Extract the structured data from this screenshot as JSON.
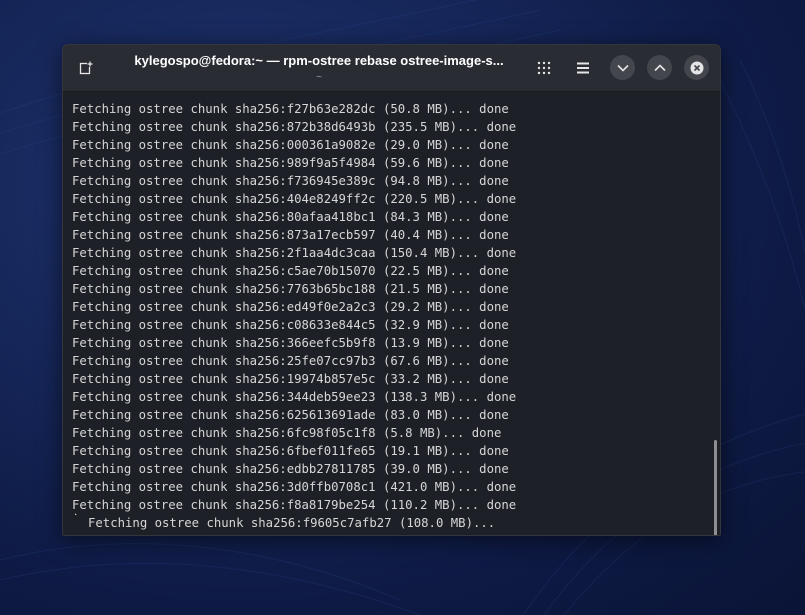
{
  "window": {
    "title": "kylegospo@fedora:~ — rpm-ostree rebase ostree-image-s...",
    "subtitle": "~"
  },
  "icons": {
    "new_tab": "new-tab-icon",
    "grid": "grid-menu-icon",
    "menu": "hamburger-menu-icon",
    "minimize": "chevron-down-icon",
    "maximize": "chevron-up-icon",
    "close": "close-icon"
  },
  "terminal": {
    "lines": [
      "Fetching ostree chunk sha256:f27b63e282dc (50.8 MB)... done",
      "Fetching ostree chunk sha256:872b38d6493b (235.5 MB)... done",
      "Fetching ostree chunk sha256:000361a9082e (29.0 MB)... done",
      "Fetching ostree chunk sha256:989f9a5f4984 (59.6 MB)... done",
      "Fetching ostree chunk sha256:f736945e389c (94.8 MB)... done",
      "Fetching ostree chunk sha256:404e8249ff2c (220.5 MB)... done",
      "Fetching ostree chunk sha256:80afaa418bc1 (84.3 MB)... done",
      "Fetching ostree chunk sha256:873a17ecb597 (40.4 MB)... done",
      "Fetching ostree chunk sha256:2f1aa4dc3caa (150.4 MB)... done",
      "Fetching ostree chunk sha256:c5ae70b15070 (22.5 MB)... done",
      "Fetching ostree chunk sha256:7763b65bc188 (21.5 MB)... done",
      "Fetching ostree chunk sha256:ed49f0e2a2c3 (29.2 MB)... done",
      "Fetching ostree chunk sha256:c08633e844c5 (32.9 MB)... done",
      "Fetching ostree chunk sha256:366eefc5b9f8 (13.9 MB)... done",
      "Fetching ostree chunk sha256:25fe07cc97b3 (67.6 MB)... done",
      "Fetching ostree chunk sha256:19974b857e5c (33.2 MB)... done",
      "Fetching ostree chunk sha256:344deb59ee23 (138.3 MB)... done",
      "Fetching ostree chunk sha256:625613691ade (83.0 MB)... done",
      "Fetching ostree chunk sha256:6fc98f05c1f8 (5.8 MB)... done",
      "Fetching ostree chunk sha256:6fbef011fe65 (19.1 MB)... done",
      "Fetching ostree chunk sha256:edbb27811785 (39.0 MB)... done",
      "Fetching ostree chunk sha256:3d0ffb0708c1 (421.0 MB)... done",
      "Fetching ostree chunk sha256:f8a8179be254 (110.2 MB)... done"
    ],
    "spinner": "˙",
    "current_line": "Fetching ostree chunk sha256:f9605c7afb27 (108.0 MB)..."
  },
  "colors": {
    "terminal_bg": "#1e2027",
    "titlebar_bg": "#2a2c33",
    "text": "#d6d6d6"
  }
}
